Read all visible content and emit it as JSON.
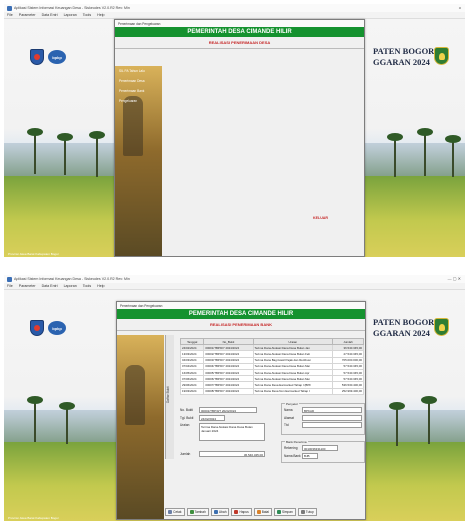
{
  "shot1": {
    "window_title": "Aplikasi Sistem Informasi Keuangan Desa - Siskeudes V2.0.R2 Rev: Min",
    "window_controls": "o",
    "menu": [
      "File",
      "Parameter",
      "Data Entri",
      "Laporan",
      "Tools",
      "Help"
    ],
    "regency_title": "PATEN BOGOR",
    "regency_year": "GGARAN 2024",
    "logo_text": "bpkp",
    "footer": "Provinsi Jawa Barat Kabupaten Bogor",
    "dialog": {
      "title": "Penerimaan dan Pengeluaran",
      "header": "PEMERINTAH DESA CIMANDE HILIR",
      "subheader": "REALISASI PENERIMAAN DESA",
      "menu_items": [
        "SIL PA Tahun Lalu",
        "Penerimaan Desa",
        "Penerimaan Bank",
        "Pengeluaran"
      ],
      "exit_label": "KELUAR"
    }
  },
  "shot2": {
    "window_title": "Aplikasi Sistem Informasi Keuangan Desa - Siskeudes V2.0.R2 Rev: Min",
    "window_controls": "—  ▢  ✕",
    "menu": [
      "File",
      "Parameter",
      "Data Entri",
      "Laporan",
      "Tools",
      "Help"
    ],
    "regency_title": "PATEN BOGOR",
    "regency_year": "GGARAN 2024",
    "logo_text": "bpkp",
    "footer": "Provinsi Jawa Barat Kabupaten Bogor",
    "dialog": {
      "title": "Penerimaan dan Pengeluaran",
      "header": "PEMERINTAH DESA CIMANDE HILIR",
      "subheader": "REALISASI PENERIMAAN BANK",
      "selection_tab": "Daftar Bukti",
      "table": {
        "columns": [
          "Tanggal",
          "No_Bukti",
          "Uraian",
          "Jumlah"
        ],
        "rows": [
          [
            "24/02/2024",
            "00001/TBP/0/7 2024/2024",
            "Terima Dana Alokasi Dana Desa Bulan Jan",
            "36.540.345,00"
          ],
          [
            "13/03/2024",
            "00002/TBP/0/7 2024/2024",
            "Terima Dana Alokasi Dana Desa Bulan Feb",
            "27.540.345,00"
          ],
          [
            "04/03/2024",
            "00003/TBP/0/7 2024/2024",
            "Terima Dana Bagi Hasil Pajak dan Retribusi",
            "705.000.000,00"
          ],
          [
            "07/04/2024",
            "00004/TBP/0/7 2024/2024",
            "Terima Dana Alokasi Dana Desa Bulan Mar",
            "57.540.345,00"
          ],
          [
            "16/05/2024",
            "00005/TBP/0/7 2024/2024",
            "Terima Dana Alokasi Dana Desa Bulan Apr",
            "57.540.345,00"
          ],
          [
            "07/06/2024",
            "00006/TBP/0/7 2024/2024",
            "Terima Dana Alokasi Dana Desa Bulan Mei",
            "57.540.345,00"
          ],
          [
            "29/06/2024",
            "00007/TBP/0/7 2024/2024",
            "Terima Dana Desa Earmarked Tahap I (BPF",
            "536.530.400,00"
          ],
          [
            "19/03/2024",
            "00008/TBP/0/7 2024/2024",
            "Terima Dana Desa Non Earmarked Tahap I",
            "252.999.400,00"
          ]
        ]
      },
      "form": {
        "no_bukti_label": "No. Bukti",
        "no_bukti_value": "00001/TBP/0/7 2024/2024",
        "tgl_label": "Tgl. Bukti",
        "tgl_value": "24/02/2024",
        "uraian_label": "Uraian",
        "uraian_value": "Terima Dana Alokasi Dana Desa Bulan Januari 2024",
        "jumlah_label": "Jumlah",
        "jumlah_value": "36.540.345,00"
      },
      "penyetor": {
        "caption": "Penyetor",
        "nama_label": "Nama",
        "nama_value": "BPKAD",
        "alamat_label": "Alamat",
        "alamat_value": "",
        "ttd_label": "Ttd",
        "ttd_value": ""
      },
      "bank": {
        "caption": "Bank Penerima",
        "rekening_label": "Rekening",
        "rekening_value": "0010036331100",
        "nama_bank_label": "Nama Bank",
        "nama_bank_value": "BJB"
      },
      "buttons": [
        "Cetak",
        "Tambah",
        "Ubah",
        "Hapus",
        "Batal",
        "Simpan",
        "Tutup"
      ],
      "colors": {
        "header": "#15922f",
        "subheader": "#c62828"
      }
    }
  }
}
